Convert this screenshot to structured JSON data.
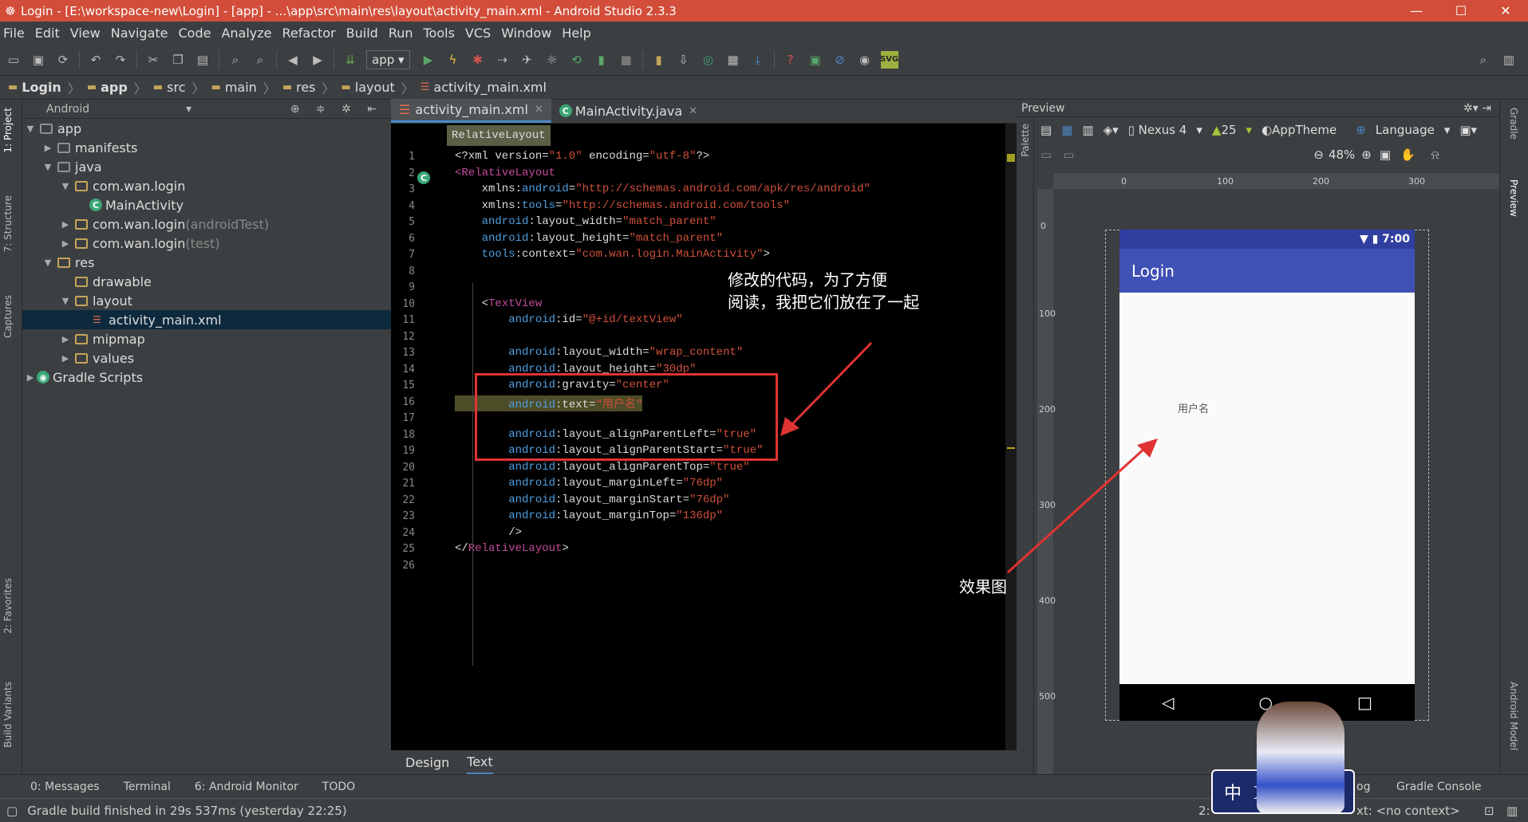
{
  "window": {
    "title": "Login - [E:\\workspace-new\\Login] - [app] - ...\\app\\src\\main\\res\\layout\\activity_main.xml - Android Studio 2.3.3",
    "min": "—",
    "max": "☐",
    "close": "✕"
  },
  "menu": [
    "File",
    "Edit",
    "View",
    "Navigate",
    "Code",
    "Analyze",
    "Refactor",
    "Build",
    "Run",
    "Tools",
    "VCS",
    "Window",
    "Help"
  ],
  "toolbar": {
    "run_config": "app"
  },
  "breadcrumbs": [
    "Login",
    "app",
    "src",
    "main",
    "res",
    "layout",
    "activity_main.xml"
  ],
  "left_tabs": [
    "1: Project",
    "7: Structure",
    "Captures",
    "2: Favorites",
    "Build Variants"
  ],
  "project": {
    "view_mode": "Android",
    "tree": [
      {
        "label": "app",
        "suffix": "",
        "depth": 0,
        "arrow": "▼",
        "icon": "folder"
      },
      {
        "label": "manifests",
        "suffix": "",
        "depth": 1,
        "arrow": "▶",
        "icon": "folder"
      },
      {
        "label": "java",
        "suffix": "",
        "depth": 1,
        "arrow": "▼",
        "icon": "folder"
      },
      {
        "label": "com.wan.login",
        "suffix": "",
        "depth": 2,
        "arrow": "▼",
        "icon": "pkg"
      },
      {
        "label": "MainActivity",
        "suffix": "",
        "depth": 3,
        "arrow": "",
        "icon": "class"
      },
      {
        "label": "com.wan.login",
        "suffix": " (androidTest)",
        "depth": 2,
        "arrow": "▶",
        "icon": "pkg"
      },
      {
        "label": "com.wan.login",
        "suffix": " (test)",
        "depth": 2,
        "arrow": "▶",
        "icon": "pkg"
      },
      {
        "label": "res",
        "suffix": "",
        "depth": 1,
        "arrow": "▼",
        "icon": "res"
      },
      {
        "label": "drawable",
        "suffix": "",
        "depth": 2,
        "arrow": "",
        "icon": "pkg"
      },
      {
        "label": "layout",
        "suffix": "",
        "depth": 2,
        "arrow": "▼",
        "icon": "pkg"
      },
      {
        "label": "activity_main.xml",
        "suffix": "",
        "depth": 3,
        "arrow": "",
        "icon": "xml",
        "selected": true
      },
      {
        "label": "mipmap",
        "suffix": "",
        "depth": 2,
        "arrow": "▶",
        "icon": "pkg"
      },
      {
        "label": "values",
        "suffix": "",
        "depth": 2,
        "arrow": "▶",
        "icon": "pkg"
      },
      {
        "label": "Gradle Scripts",
        "suffix": "",
        "depth": 0,
        "arrow": "▶",
        "icon": "gradle"
      }
    ]
  },
  "editor_tabs": [
    {
      "label": "activity_main.xml",
      "active": true
    },
    {
      "label": "MainActivity.java",
      "active": false
    }
  ],
  "editor": {
    "crumb": "RelativeLayout",
    "lines": [
      [
        [
          "t-a",
          "<?xml version="
        ],
        [
          "t-str",
          "\"1.0\""
        ],
        [
          "t-a",
          " encoding="
        ],
        [
          "t-str",
          "\"utf-8\""
        ],
        [
          "t-a",
          "?>"
        ]
      ],
      [
        [
          "t-tag",
          "<RelativeLayout"
        ]
      ],
      [
        [
          "t-a",
          "    xmlns:"
        ],
        [
          "t-kw",
          "android"
        ],
        [
          "t-a",
          "="
        ],
        [
          "t-str",
          "\"http://schemas.android.com/apk/res/android\""
        ]
      ],
      [
        [
          "t-a",
          "    xmlns:"
        ],
        [
          "t-kw",
          "tools"
        ],
        [
          "t-a",
          "="
        ],
        [
          "t-str",
          "\"http://schemas.android.com/tools\""
        ]
      ],
      [
        [
          "t-kw",
          "    android"
        ],
        [
          "t-a",
          ":layout_width="
        ],
        [
          "t-str",
          "\"match_parent\""
        ]
      ],
      [
        [
          "t-kw",
          "    android"
        ],
        [
          "t-a",
          ":layout_height="
        ],
        [
          "t-str",
          "\"match_parent\""
        ]
      ],
      [
        [
          "t-kw",
          "    tools"
        ],
        [
          "t-a",
          ":context="
        ],
        [
          "t-str",
          "\"com.wan.login.MainActivity\""
        ],
        [
          "t-a",
          ">"
        ]
      ],
      [],
      [],
      [
        [
          "t-a",
          "    <"
        ],
        [
          "t-tag",
          "TextView"
        ]
      ],
      [
        [
          "t-kw",
          "        android"
        ],
        [
          "t-a",
          ":id="
        ],
        [
          "t-str",
          "\"@+id/textView\""
        ]
      ],
      [],
      [
        [
          "t-kw",
          "        android"
        ],
        [
          "t-a",
          ":layout_width="
        ],
        [
          "t-str",
          "\"wrap_content\""
        ]
      ],
      [
        [
          "t-kw",
          "        android"
        ],
        [
          "t-a",
          ":layout_height="
        ],
        [
          "t-str",
          "\"30dp\""
        ]
      ],
      [
        [
          "t-kw",
          "        android"
        ],
        [
          "t-a",
          ":gravity="
        ],
        [
          "t-str",
          "\"center\""
        ]
      ],
      [
        [
          "t-kw",
          "        android"
        ],
        [
          "t-a",
          ":text="
        ],
        [
          "t-str",
          "\"用户名\""
        ]
      ],
      [],
      [
        [
          "t-kw",
          "        android"
        ],
        [
          "t-a",
          ":layout_alignParentLeft="
        ],
        [
          "t-str",
          "\"true\""
        ]
      ],
      [
        [
          "t-kw",
          "        android"
        ],
        [
          "t-a",
          ":layout_alignParentStart="
        ],
        [
          "t-str",
          "\"true\""
        ]
      ],
      [
        [
          "t-kw",
          "        android"
        ],
        [
          "t-a",
          ":layout_alignParentTop="
        ],
        [
          "t-str",
          "\"true\""
        ]
      ],
      [
        [
          "t-kw",
          "        android"
        ],
        [
          "t-a",
          ":layout_marginLeft="
        ],
        [
          "t-str",
          "\"76dp\""
        ]
      ],
      [
        [
          "t-kw",
          "        android"
        ],
        [
          "t-a",
          ":layout_marginStart="
        ],
        [
          "t-str",
          "\"76dp\""
        ]
      ],
      [
        [
          "t-kw",
          "        android"
        ],
        [
          "t-a",
          ":layout_marginTop="
        ],
        [
          "t-str",
          "\"136dp\""
        ]
      ],
      [
        [
          "t-a",
          "        />"
        ]
      ],
      [
        [
          "t-a",
          "</"
        ],
        [
          "t-tag",
          "RelativeLayout"
        ],
        [
          "t-a",
          ">"
        ]
      ],
      []
    ],
    "annotation_code": "修改的代码，为了方便\n阅读，我把它们放在了一起",
    "annotation_effect": "效果图"
  },
  "editor_bottom_tabs": [
    "Design",
    "Text"
  ],
  "preview": {
    "title": "Preview",
    "device": "Nexus 4",
    "api": "25",
    "theme": "AppTheme",
    "language": "Language",
    "zoom": "48%",
    "ruler_h": [
      "0",
      "100",
      "200",
      "300"
    ],
    "ruler_v": [
      "0",
      "100",
      "200",
      "300",
      "400",
      "500"
    ],
    "status_time": "7:00",
    "app_title": "Login",
    "text_view": "用户名",
    "palette_tab": "Palette",
    "nav_back": "◁",
    "nav_home": "○",
    "nav_recent": "□"
  },
  "right_tabs": [
    "Gradle",
    "Preview",
    "Android Model"
  ],
  "bottom_tabs": [
    "0: Messages",
    "Terminal",
    "6: Android Monitor",
    "TODO",
    "Gradle Console"
  ],
  "bottom_extra": [
    "og",
    "xt: <no context>",
    "2:"
  ],
  "status": "Gradle build finished in 29s 537ms (yesterday 22:25)",
  "badge_text": "中 ☽"
}
